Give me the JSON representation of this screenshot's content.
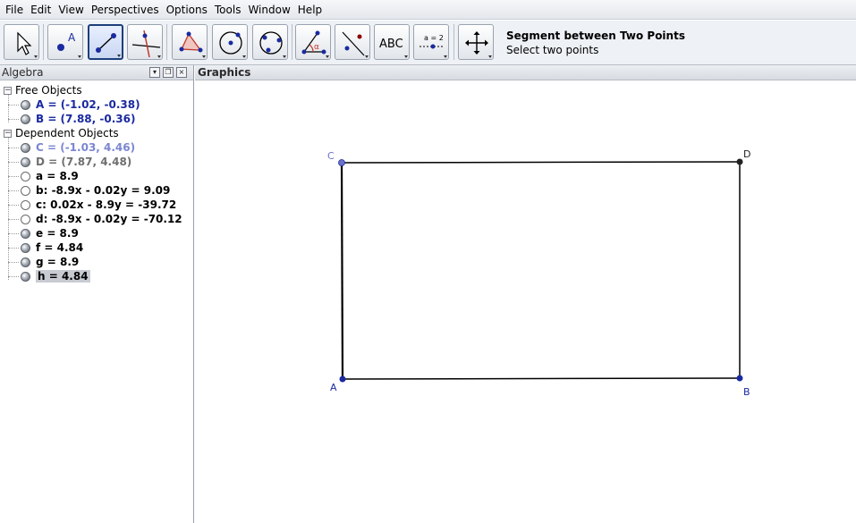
{
  "menubar": {
    "items": [
      "File",
      "Edit",
      "View",
      "Perspectives",
      "Options",
      "Tools",
      "Window",
      "Help"
    ]
  },
  "toolbar": {
    "tools": [
      {
        "name": "move-tool"
      },
      {
        "name": "new-point-tool"
      },
      {
        "name": "segment-tool",
        "selected": true
      },
      {
        "name": "perpendicular-line-tool"
      },
      {
        "name": "polygon-tool"
      },
      {
        "name": "circle-tool"
      },
      {
        "name": "conic-tool"
      },
      {
        "name": "angle-tool"
      },
      {
        "name": "reflect-tool"
      },
      {
        "name": "text-tool",
        "label": "ABC"
      },
      {
        "name": "slider-tool",
        "label": "a = 2"
      },
      {
        "name": "move-graphics-tool"
      }
    ],
    "tooltip_title": "Segment between Two Points",
    "tooltip_desc": "Select two points"
  },
  "algebra": {
    "title": "Algebra",
    "folders": [
      {
        "label": "Free Objects",
        "items": [
          {
            "text": "A = (-1.02, -0.38)",
            "style": "free",
            "filled": true
          },
          {
            "text": "B = (7.88, -0.36)",
            "style": "free",
            "filled": true
          }
        ]
      },
      {
        "label": "Dependent Objects",
        "items": [
          {
            "text": "C = (-1.03, 4.46)",
            "style": "light",
            "filled": true
          },
          {
            "text": "D = (7.87, 4.48)",
            "style": "dep-point",
            "filled": true
          },
          {
            "text": "a = 8.9",
            "style": "dep",
            "filled": false
          },
          {
            "text": "b: -8.9x - 0.02y = 9.09",
            "style": "dep",
            "filled": false
          },
          {
            "text": "c: 0.02x - 8.9y = -39.72",
            "style": "dep",
            "filled": false
          },
          {
            "text": "d: -8.9x - 0.02y = -70.12",
            "style": "dep",
            "filled": false
          },
          {
            "text": "e = 8.9",
            "style": "dep",
            "filled": true
          },
          {
            "text": "f = 4.84",
            "style": "dep",
            "filled": true
          },
          {
            "text": "g = 8.9",
            "style": "dep",
            "filled": true
          },
          {
            "text": "h = 4.84",
            "style": "dep",
            "filled": true,
            "selected": true
          }
        ]
      }
    ]
  },
  "graphics": {
    "title": "Graphics",
    "points": [
      {
        "label": "A",
        "color": "#1a2aa0"
      },
      {
        "label": "B",
        "color": "#1a2aa0"
      },
      {
        "label": "C",
        "color": "#6a72c8"
      },
      {
        "label": "D",
        "color": "#222222"
      }
    ]
  },
  "colors": {
    "free_point": "#1a2aa0",
    "dependent_point": "#222222",
    "segment": "#000000",
    "selected_tool_border": "#1d3f7a"
  }
}
